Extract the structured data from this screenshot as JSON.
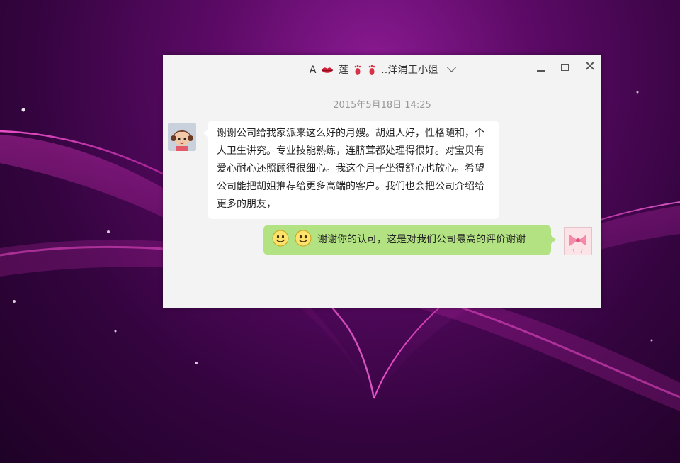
{
  "window": {
    "title_prefix": "A",
    "contact_name": "莲",
    "contact_suffix": "..洋浦王小姐",
    "close_glyph": "✕",
    "colors": {
      "background": "#f3f3f3",
      "incoming_bubble": "#ffffff",
      "outgoing_bubble": "#b2e281"
    }
  },
  "chat": {
    "timestamp": "2015年5月18日 14:25",
    "messages": [
      {
        "direction": "incoming",
        "text": "谢谢公司给我家派来这么好的月嫂。胡姐人好，性格随和，个人卫生讲究。专业技能熟练，连脐茸都处理得很好。对宝贝有爱心耐心还照顾得很细心。我这个月子坐得舒心也放心。希望公司能把胡姐推荐给更多高端的客户。我们也会把公司介绍给更多的朋友，"
      },
      {
        "direction": "outgoing",
        "emoji": [
          "smile-emoji",
          "smile-emoji"
        ],
        "text": "谢谢你的认可，这是对我们公司最高的评价谢谢"
      }
    ]
  },
  "wallpaper": {
    "colors": {
      "base": "#34043f",
      "glow": "#8a1a92",
      "ribbon": "#ff4fd0"
    }
  }
}
